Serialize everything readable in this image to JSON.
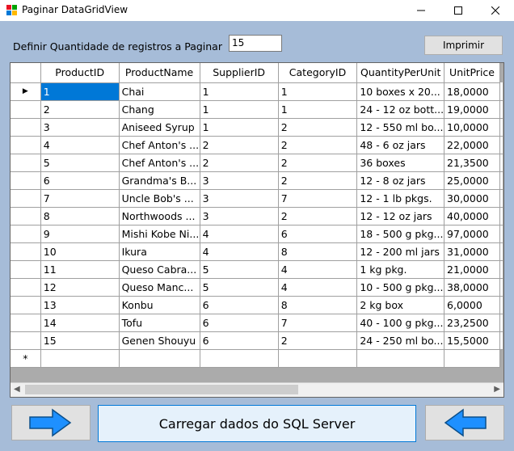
{
  "window": {
    "title": "Paginar DataGridView"
  },
  "toolbar": {
    "page_size_label": "Definir Quantidade de registros a Paginar",
    "page_size_value": "15",
    "print_label": "Imprimir"
  },
  "grid": {
    "columns": [
      "ProductID",
      "ProductName",
      "SupplierID",
      "CategoryID",
      "QuantityPerUnit",
      "UnitPrice"
    ],
    "rows": [
      [
        "1",
        "Chai",
        "1",
        "1",
        "10 boxes x 20...",
        "18,0000"
      ],
      [
        "2",
        "Chang",
        "1",
        "1",
        "24 - 12 oz bott...",
        "19,0000"
      ],
      [
        "3",
        "Aniseed Syrup",
        "1",
        "2",
        "12 - 550 ml bo...",
        "10,0000"
      ],
      [
        "4",
        "Chef Anton's ...",
        "2",
        "2",
        "48 - 6 oz jars",
        "22,0000"
      ],
      [
        "5",
        "Chef Anton's ...",
        "2",
        "2",
        "36 boxes",
        "21,3500"
      ],
      [
        "6",
        "Grandma's B...",
        "3",
        "2",
        "12 - 8 oz jars",
        "25,0000"
      ],
      [
        "7",
        "Uncle Bob's ...",
        "3",
        "7",
        "12 - 1 lb pkgs.",
        "30,0000"
      ],
      [
        "8",
        "Northwoods ...",
        "3",
        "2",
        "12 - 12 oz jars",
        "40,0000"
      ],
      [
        "9",
        "Mishi Kobe Ni...",
        "4",
        "6",
        "18 - 500 g pkg...",
        "97,0000"
      ],
      [
        "10",
        "Ikura",
        "4",
        "8",
        "12 - 200 ml jars",
        "31,0000"
      ],
      [
        "11",
        "Queso Cabra...",
        "5",
        "4",
        "1 kg pkg.",
        "21,0000"
      ],
      [
        "12",
        "Queso Manc...",
        "5",
        "4",
        "10 - 500 g pkg...",
        "38,0000"
      ],
      [
        "13",
        "Konbu",
        "6",
        "8",
        "2 kg box",
        "6,0000"
      ],
      [
        "14",
        "Tofu",
        "6",
        "7",
        "40 - 100 g pkg...",
        "23,2500"
      ],
      [
        "15",
        "Genen Shouyu",
        "6",
        "2",
        "24 - 250 ml bo...",
        "15,5000"
      ]
    ],
    "current_row_marker": "▶",
    "new_row_marker": "*"
  },
  "footer": {
    "load_label": "Carregar dados do SQL Server"
  },
  "colors": {
    "client_bg": "#a6bcd8",
    "selection": "#0078d7",
    "arrow": "#1e90ff"
  },
  "icons": {
    "prev": "arrow-right-icon",
    "next": "arrow-left-icon"
  }
}
